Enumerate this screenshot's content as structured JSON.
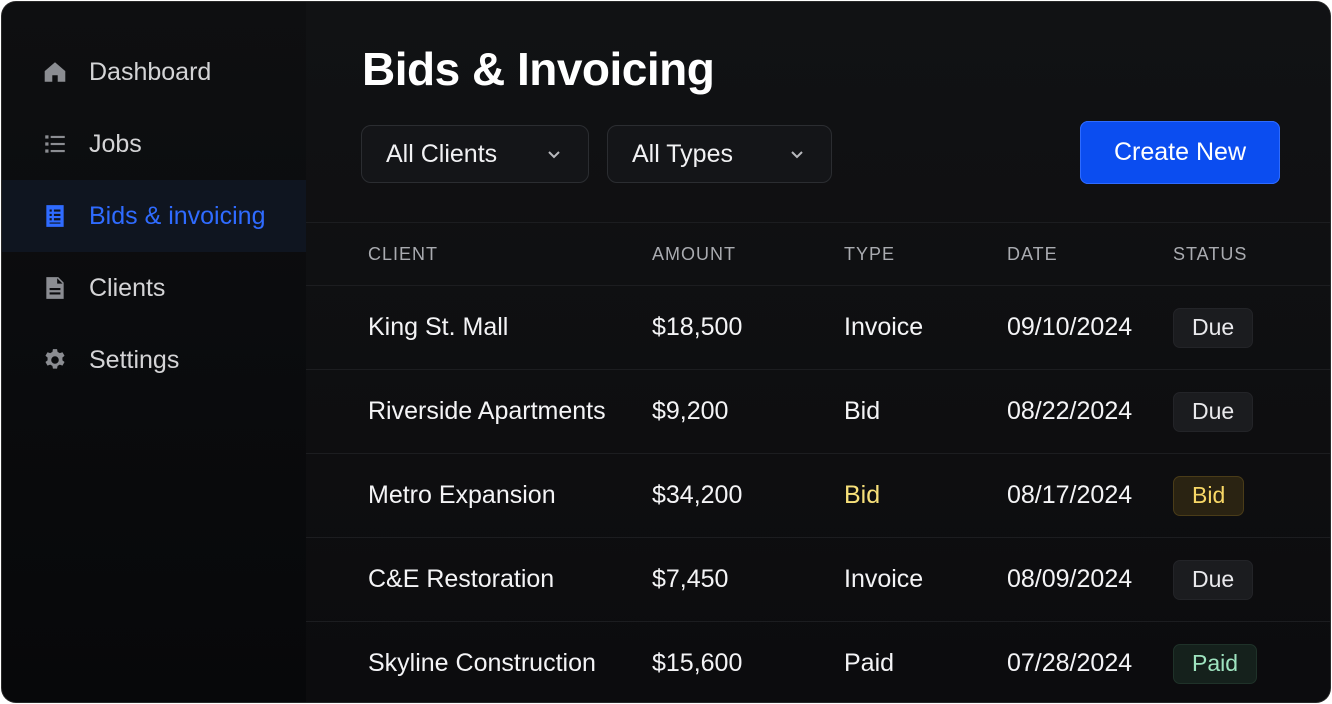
{
  "sidebar": {
    "items": [
      {
        "label": "Dashboard",
        "icon": "home-icon"
      },
      {
        "label": "Jobs",
        "icon": "list-icon"
      },
      {
        "label": "Bids & invoicing",
        "icon": "document-icon",
        "active": true
      },
      {
        "label": "Clients",
        "icon": "file-icon"
      },
      {
        "label": "Settings",
        "icon": "gear-icon"
      }
    ]
  },
  "main": {
    "title": "Bids & Invoicing",
    "filters": {
      "clients": "All Clients",
      "types": "All Types"
    },
    "create_label": "Create New"
  },
  "table": {
    "headers": [
      "CLIENT",
      "AMOUNT",
      "TYPE",
      "DATE",
      "STATUS"
    ],
    "rows": [
      {
        "client": "King St. Mall",
        "amount": "$18,500",
        "type": "Invoice",
        "date": "09/10/2024",
        "status": "Due"
      },
      {
        "client": "Riverside Apartments",
        "amount": "$9,200",
        "type": "Bid",
        "date": "08/22/2024",
        "status": "Due"
      },
      {
        "client": "Metro Expansion",
        "amount": "$34,200",
        "type": "Bid",
        "date": "08/17/2024",
        "status": "Bid"
      },
      {
        "client": "C&E Restoration",
        "amount": "$7,450",
        "type": "Invoice",
        "date": "08/09/2024",
        "status": "Due"
      },
      {
        "client": "Skyline Construction",
        "amount": "$15,600",
        "type": "Paid",
        "date": "07/28/2024",
        "status": "Paid"
      }
    ]
  },
  "colors": {
    "accent": "#2f6bff",
    "button": "#0b4df0",
    "bid_badge": "#f7d766",
    "paid_badge": "#9ee3bf"
  }
}
